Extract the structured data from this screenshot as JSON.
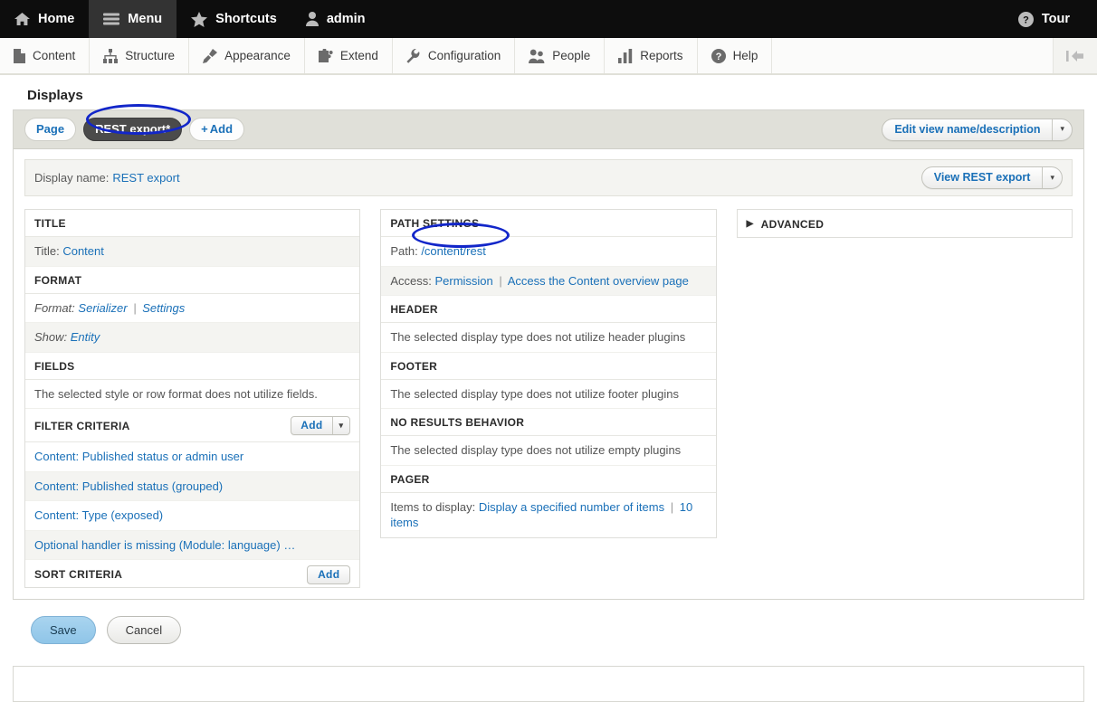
{
  "toolbar": {
    "items": [
      {
        "label": "Home",
        "icon": "home-icon",
        "active": false
      },
      {
        "label": "Menu",
        "icon": "menu-icon",
        "active": true
      },
      {
        "label": "Shortcuts",
        "icon": "star-icon",
        "active": false
      },
      {
        "label": "admin",
        "icon": "user-icon",
        "active": false
      }
    ],
    "tour": {
      "label": "Tour",
      "icon": "help-circle-icon"
    }
  },
  "admin_menu": {
    "items": [
      {
        "label": "Content",
        "icon": "file-icon"
      },
      {
        "label": "Structure",
        "icon": "sitemap-icon"
      },
      {
        "label": "Appearance",
        "icon": "paintbrush-icon"
      },
      {
        "label": "Extend",
        "icon": "puzzle-icon"
      },
      {
        "label": "Configuration",
        "icon": "wrench-icon"
      },
      {
        "label": "People",
        "icon": "people-icon"
      },
      {
        "label": "Reports",
        "icon": "bar-chart-icon"
      },
      {
        "label": "Help",
        "icon": "question-circle-icon"
      }
    ],
    "collapse": {
      "icon": "collapse-left-icon"
    }
  },
  "page": {
    "section_title": "Displays"
  },
  "display_tabs": {
    "tabs": [
      {
        "label": "Page",
        "active": false
      },
      {
        "label": "REST export*",
        "active": true
      }
    ],
    "add": {
      "plus": "+",
      "label": "Add"
    },
    "edit_view": {
      "label": "Edit view name/description",
      "toggle": "▾"
    }
  },
  "display_name": {
    "label": "Display name:",
    "value": "REST export",
    "view_button": {
      "label": "View REST export",
      "toggle": "▾"
    }
  },
  "columns": {
    "left": [
      {
        "header": "TITLE",
        "button": null,
        "rows": [
          {
            "label": "Title:",
            "links": [
              "Content"
            ],
            "shade": true,
            "italic": false
          }
        ]
      },
      {
        "header": "FORMAT",
        "button": null,
        "rows": [
          {
            "label": "Format:",
            "links": [
              "Serializer",
              "Settings"
            ],
            "shade": false,
            "italic": true
          },
          {
            "label": "Show:",
            "links": [
              "Entity"
            ],
            "shade": true,
            "italic": true
          }
        ]
      },
      {
        "header": "FIELDS",
        "button": null,
        "rows": [
          {
            "text": "The selected style or row format does not utilize fields.",
            "shade": false,
            "italic": false
          }
        ]
      },
      {
        "header": "FILTER CRITERIA",
        "button": {
          "type": "dropbutton",
          "label": "Add",
          "toggle": "▾"
        },
        "rows": [
          {
            "links": [
              "Content: Published status or admin user"
            ],
            "shade": false
          },
          {
            "links": [
              "Content: Published status (grouped)"
            ],
            "shade": true
          },
          {
            "links": [
              "Content: Type (exposed)"
            ],
            "shade": false
          },
          {
            "links": [
              "Optional handler is missing (Module: language) …"
            ],
            "shade": true
          }
        ]
      },
      {
        "header": "SORT CRITERIA",
        "button": {
          "type": "plain",
          "label": "Add"
        },
        "rows": []
      }
    ],
    "middle": [
      {
        "header": "PATH SETTINGS",
        "rows": [
          {
            "label": "Path:",
            "links": [
              "/content/rest"
            ],
            "shade": false
          },
          {
            "label": "Access:",
            "links": [
              "Permission",
              "Access the Content overview page"
            ],
            "shade": true
          }
        ]
      },
      {
        "header": "HEADER",
        "rows": [
          {
            "text": "The selected display type does not utilize header plugins",
            "shade": false
          }
        ]
      },
      {
        "header": "FOOTER",
        "rows": [
          {
            "text": "The selected display type does not utilize footer plugins",
            "shade": false
          }
        ]
      },
      {
        "header": "NO RESULTS BEHAVIOR",
        "rows": [
          {
            "text": "The selected display type does not utilize empty plugins",
            "shade": false
          }
        ]
      },
      {
        "header": "PAGER",
        "rows": [
          {
            "label": "Items to display:",
            "links": [
              "Display a specified number of items",
              "10 items"
            ],
            "shade": false
          }
        ]
      }
    ],
    "advanced": {
      "header": "ADVANCED",
      "triangle": "▶"
    }
  },
  "actions": {
    "save": "Save",
    "cancel": "Cancel"
  },
  "annotations": {
    "accent_color": "#1226c9",
    "targets": [
      "REST export*",
      "/content/rest"
    ]
  }
}
